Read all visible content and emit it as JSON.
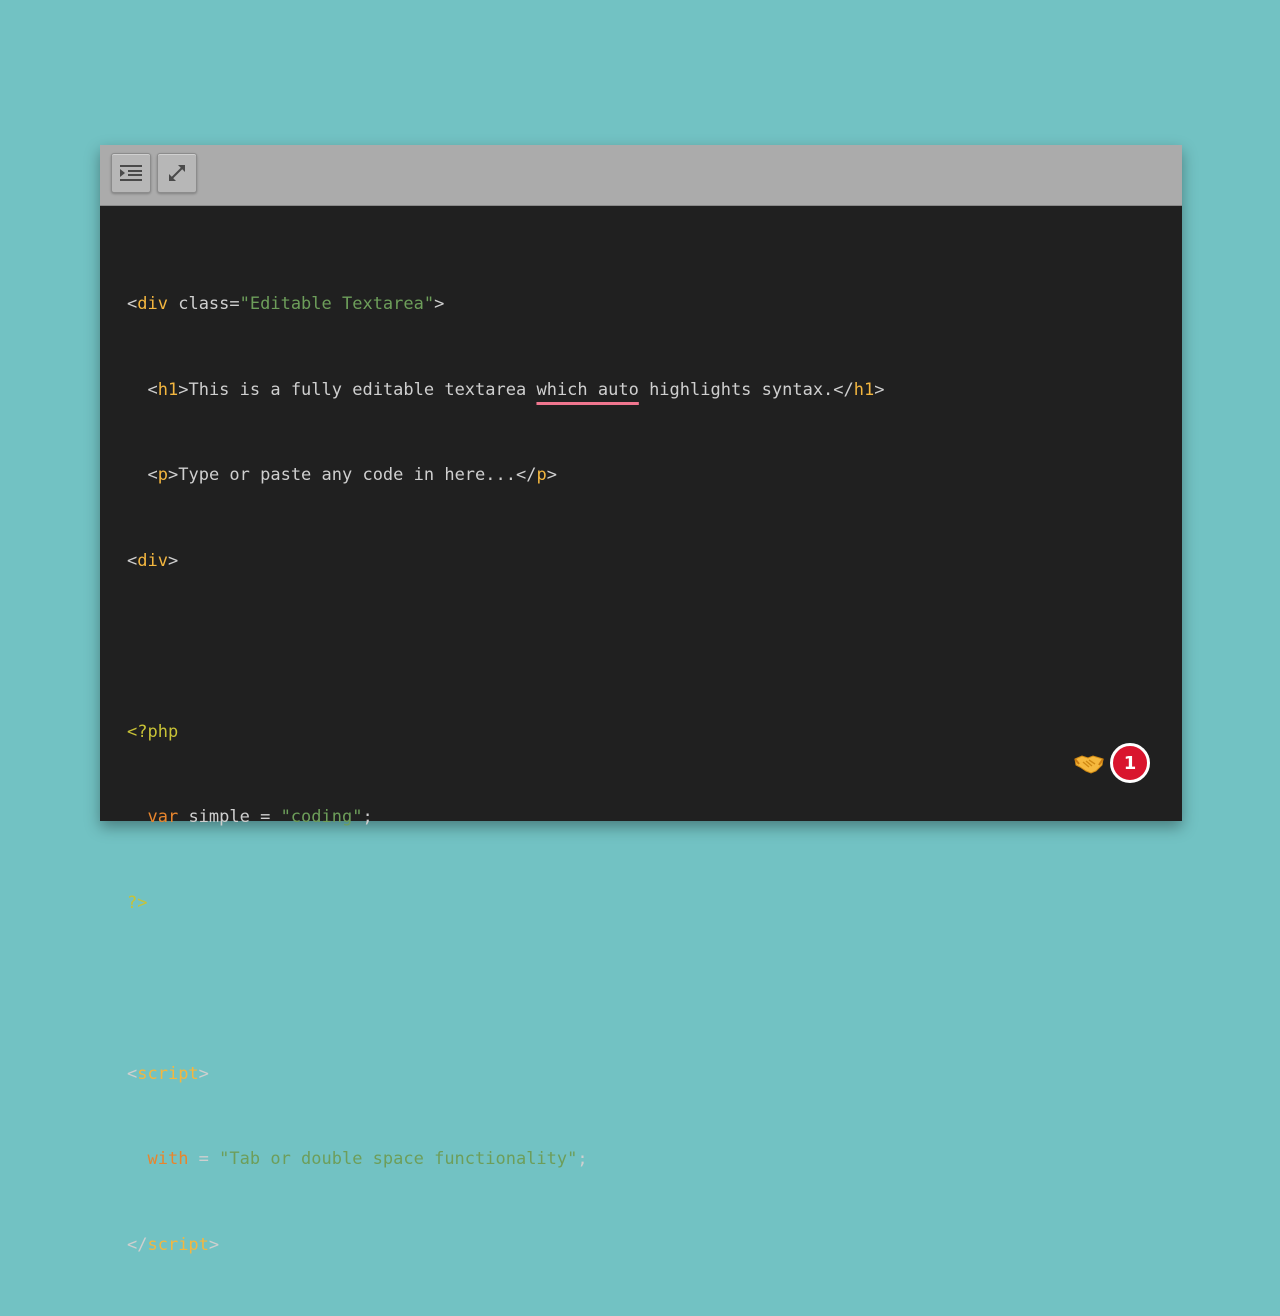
{
  "toolbar": {
    "buttons": [
      {
        "icon": "indent-icon"
      },
      {
        "icon": "expand-icon"
      }
    ]
  },
  "colors": {
    "background": "#72c2c3",
    "toolbar": "#ababab",
    "editor": "#202020",
    "tag": "#f3b63f",
    "string": "#6d9e5a",
    "php": "#c8c236",
    "keyword": "#e8852d",
    "badge": "#d9152e"
  },
  "code": {
    "l1": {
      "open": "<",
      "tag": "div",
      "sp": " ",
      "attr": "class=",
      "val": "\"Editable Textarea\"",
      "close": ">"
    },
    "l2": {
      "indent": "  ",
      "lt1": "<",
      "tag1": "h1",
      "gt1": ">",
      "text_a": "This is a fully editable textarea ",
      "misspelled": "which auto",
      "text_b": " highlights syntax.",
      "lt2": "</",
      "tag2": "h1",
      "gt2": ">"
    },
    "l3": {
      "indent": "  ",
      "lt1": "<",
      "tag1": "p",
      "gt1": ">",
      "text": "Type or paste any code in here...",
      "lt2": "</",
      "tag2": "p",
      "gt2": ">"
    },
    "l4": {
      "lt": "<",
      "tag": "div",
      "gt": ">"
    },
    "l6": {
      "php_open": "<?php"
    },
    "l7": {
      "indent": "  ",
      "kw": "var",
      "rest": " simple = ",
      "str": "\"coding\"",
      "end": ";"
    },
    "l8": {
      "php_close": "?>"
    },
    "l10": {
      "lt": "<",
      "tag": "script",
      "gt": ">"
    },
    "l11": {
      "indent": "  ",
      "kw": "with",
      "rest": " = ",
      "str": "\"Tab or double space functionality\"",
      "end": ";"
    },
    "l12": {
      "lt": "</",
      "tag": "script",
      "gt": ">"
    }
  },
  "widgets": {
    "handshake_icon": "handshake-icon",
    "notification_count": "1"
  }
}
